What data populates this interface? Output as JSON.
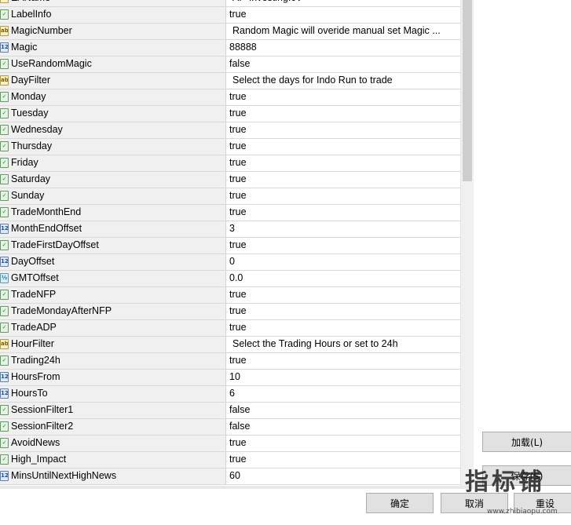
{
  "parameters": [
    {
      "type": "str",
      "name": "EAName",
      "value": "AP-InvestingIcV"
    },
    {
      "type": "bool",
      "name": "LabelInfo",
      "value": "true"
    },
    {
      "type": "str",
      "name": "MagicNumber",
      "value": "Random Magic will overide manual set Magic ..."
    },
    {
      "type": "int",
      "name": "Magic",
      "value": "88888"
    },
    {
      "type": "bool",
      "name": "UseRandomMagic",
      "value": "false"
    },
    {
      "type": "str",
      "name": "DayFilter",
      "value": "Select the days for Indo Run to trade"
    },
    {
      "type": "bool",
      "name": "Monday",
      "value": "true"
    },
    {
      "type": "bool",
      "name": "Tuesday",
      "value": "true"
    },
    {
      "type": "bool",
      "name": "Wednesday",
      "value": "true"
    },
    {
      "type": "bool",
      "name": "Thursday",
      "value": "true"
    },
    {
      "type": "bool",
      "name": "Friday",
      "value": "true"
    },
    {
      "type": "bool",
      "name": "Saturday",
      "value": "true"
    },
    {
      "type": "bool",
      "name": "Sunday",
      "value": "true"
    },
    {
      "type": "bool",
      "name": "TradeMonthEnd",
      "value": "true"
    },
    {
      "type": "int",
      "name": "MonthEndOffset",
      "value": "3"
    },
    {
      "type": "bool",
      "name": "TradeFirstDayOffset",
      "value": "true"
    },
    {
      "type": "int",
      "name": "DayOffset",
      "value": "0"
    },
    {
      "type": "dbl",
      "name": "GMTOffset",
      "value": "0.0"
    },
    {
      "type": "bool",
      "name": "TradeNFP",
      "value": "true"
    },
    {
      "type": "bool",
      "name": "TradeMondayAfterNFP",
      "value": "true"
    },
    {
      "type": "bool",
      "name": "TradeADP",
      "value": "true"
    },
    {
      "type": "str",
      "name": "HourFilter",
      "value": "Select the Trading Hours or set to 24h"
    },
    {
      "type": "bool",
      "name": "Trading24h",
      "value": "true"
    },
    {
      "type": "int",
      "name": "HoursFrom",
      "value": "10"
    },
    {
      "type": "int",
      "name": "HoursTo",
      "value": "6"
    },
    {
      "type": "bool",
      "name": "SessionFilter1",
      "value": "false"
    },
    {
      "type": "bool",
      "name": "SessionFilter2",
      "value": "false"
    },
    {
      "type": "bool",
      "name": "AvoidNews",
      "value": "true"
    },
    {
      "type": "bool",
      "name": "High_Impact",
      "value": "true"
    },
    {
      "type": "int",
      "name": "MinsUntilNextHighNews",
      "value": "60"
    }
  ],
  "icons": {
    "bool": {
      "name": "bool-param-icon",
      "glyph": "✓"
    },
    "int": {
      "name": "int-param-icon",
      "glyph": "123"
    },
    "str": {
      "name": "string-param-icon",
      "glyph": "ab"
    },
    "dbl": {
      "name": "double-param-icon",
      "glyph": "½"
    }
  },
  "buttons": {
    "load": "加载(L)",
    "save": "保存(S)",
    "ok": "确定",
    "cancel": "取消",
    "reset": "重设"
  },
  "watermark": {
    "text": "指标铺",
    "sub": "www.zhibiaopu.com"
  }
}
